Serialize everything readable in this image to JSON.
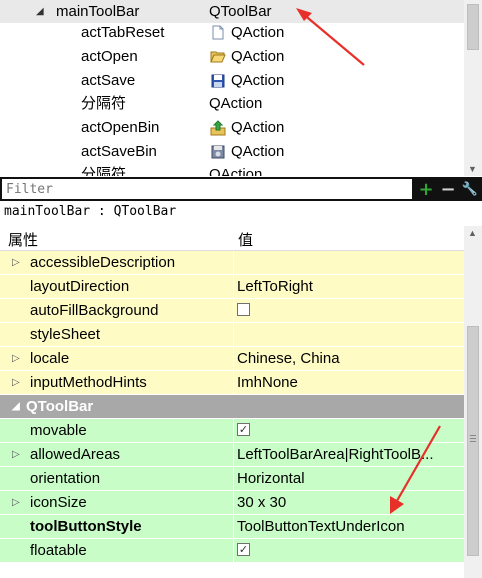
{
  "object_tree": {
    "rows": [
      {
        "name": "mainToolBar",
        "class": "QToolBar",
        "icon": "",
        "selected": true,
        "level": 0
      },
      {
        "name": "actTabReset",
        "class": "QAction",
        "icon": "document-icon",
        "level": 1
      },
      {
        "name": "actOpen",
        "class": "QAction",
        "icon": "folder-open-icon",
        "level": 1
      },
      {
        "name": "actSave",
        "class": "QAction",
        "icon": "floppy-save-icon",
        "level": 1
      },
      {
        "name": "分隔符",
        "class": "QAction",
        "icon": "",
        "level": 1
      },
      {
        "name": "actOpenBin",
        "class": "QAction",
        "icon": "upload-open-icon",
        "level": 1
      },
      {
        "name": "actSaveBin",
        "class": "QAction",
        "icon": "disk-save-icon",
        "level": 1
      },
      {
        "name": "分隔符",
        "class": "QAction",
        "icon": "",
        "level": 1
      }
    ]
  },
  "filter": {
    "placeholder": "Filter",
    "add_label": "+",
    "remove_label": "−",
    "config_label": "🔧"
  },
  "object_label": "mainToolBar : QToolBar",
  "property_editor": {
    "header_property": "属性",
    "header_value": "值",
    "rows": [
      {
        "name": "accessibleDescription",
        "value": "",
        "style": "yellow",
        "expandable": true
      },
      {
        "name": "layoutDirection",
        "value": "LeftToRight",
        "style": "yellow"
      },
      {
        "name": "autoFillBackground",
        "value": "",
        "style": "yellow",
        "checkbox": true,
        "checked": false
      },
      {
        "name": "styleSheet",
        "value": "",
        "style": "yellow"
      },
      {
        "name": "locale",
        "value": "Chinese, China",
        "style": "yellow",
        "expandable": true
      },
      {
        "name": "inputMethodHints",
        "value": "ImhNone",
        "style": "yellow",
        "expandable": true
      },
      {
        "name": "QToolBar",
        "value": "",
        "style": "section",
        "expandable": true,
        "expanded": true
      },
      {
        "name": "movable",
        "value": "",
        "style": "green",
        "checkbox": true,
        "checked": true
      },
      {
        "name": "allowedAreas",
        "value": "LeftToolBarArea|RightToolB...",
        "style": "green",
        "expandable": true
      },
      {
        "name": "orientation",
        "value": "Horizontal",
        "style": "green"
      },
      {
        "name": "iconSize",
        "value": "30 x 30",
        "style": "green",
        "expandable": true
      },
      {
        "name": "toolButtonStyle",
        "value": "ToolButtonTextUnderIcon",
        "style": "green",
        "bold": true
      },
      {
        "name": "floatable",
        "value": "",
        "style": "green",
        "checkbox": true,
        "checked": true
      }
    ]
  },
  "colors": {
    "changed_row_bg": "#fefcc4",
    "class_row_bg": "#c8fdc8",
    "section_bg": "#a8a8a8",
    "annotation_arrow": "#e8302a"
  }
}
